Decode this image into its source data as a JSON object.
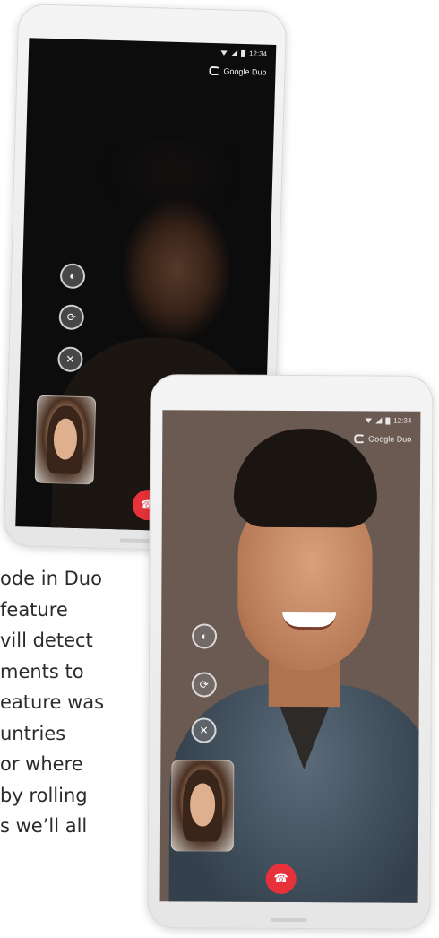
{
  "article": {
    "lines": [
      "ode in Duo",
      " feature",
      "vill detect",
      "ments to",
      "eature was",
      "untries",
      " or where",
      "by rolling",
      "s we’ll all"
    ]
  },
  "phone_back": {
    "status_time": "12:34",
    "brand": "Google Duo",
    "controls": {
      "low_light_icon": "contrast-icon",
      "switch_camera_icon": "camera-switch-icon",
      "mute_icon": "mic-off-icon"
    },
    "end_call_icon": "phone-hangup-icon"
  },
  "phone_front": {
    "status_time": "12:34",
    "brand": "Google Duo",
    "controls": {
      "low_light_icon": "contrast-icon",
      "switch_camera_icon": "camera-switch-icon",
      "mute_icon": "mic-off-icon"
    },
    "end_call_icon": "phone-hangup-icon"
  },
  "colors": {
    "end_call": "#e8323b",
    "text": "#2b2b2b"
  }
}
